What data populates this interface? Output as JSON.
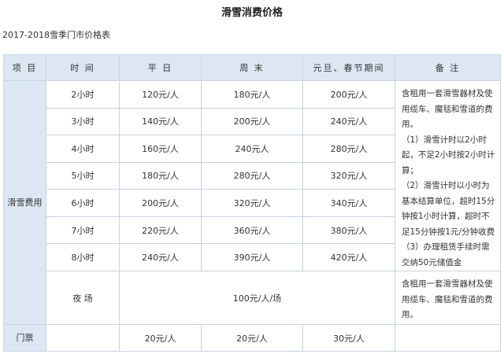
{
  "page": {
    "title": "滑雪消费价格",
    "subtitle": "2017-2018雪季门市价格表"
  },
  "table": {
    "headers": [
      "项 目",
      "时 间",
      "平 日",
      "周 末",
      "元旦、春节期间",
      "备 注"
    ],
    "category_ski": "滑雪费用",
    "rows": [
      {
        "time": "2小时",
        "weekday": "120元/人",
        "weekend": "180元/人",
        "holiday": "200元/人"
      },
      {
        "time": "3小时",
        "weekday": "140元/人",
        "weekend": "200元/人",
        "holiday": "240元/人"
      },
      {
        "time": "4小时",
        "weekday": "160元/人",
        "weekend": "240元人",
        "holiday": "280元/人"
      },
      {
        "time": "5小时",
        "weekday": "180元/人",
        "weekend": "280元/人",
        "holiday": "320元/人"
      },
      {
        "time": "6小时",
        "weekday": "200元/人",
        "weekend": "320元/人",
        "holiday": "340元/人"
      },
      {
        "time": "7小时",
        "weekday": "220元/人",
        "weekend": "360元/人",
        "holiday": "380元/人"
      },
      {
        "time": "8小时",
        "weekday": "240元/人",
        "weekend": "390元/人",
        "holiday": "420元/人"
      }
    ],
    "night": {
      "time": "夜 场",
      "price": "100元/人/场",
      "note": [
        "含租用一套滑雪器材及使",
        "用缆车、魔毯和雪道的费",
        "用。"
      ]
    },
    "ticket": {
      "label": "门票",
      "weekday": "20元/人",
      "weekend": "20元/人",
      "holiday": "30元/人"
    },
    "note_ski": [
      "含租用一套滑雪器材及使",
      "用缆车、魔毯和雪道的费",
      "用。",
      "（1）滑雪计时以2小时",
      "起，不足2小时按2小时计",
      "算；",
      "（2）滑雪计时以小时为",
      "基本结算单位，超时15分",
      "钟按1小时计算，超时不",
      "足15分钟按1元/分钟收费",
      "（3）办理租赁手续时需",
      "交纳50元储值金"
    ]
  }
}
